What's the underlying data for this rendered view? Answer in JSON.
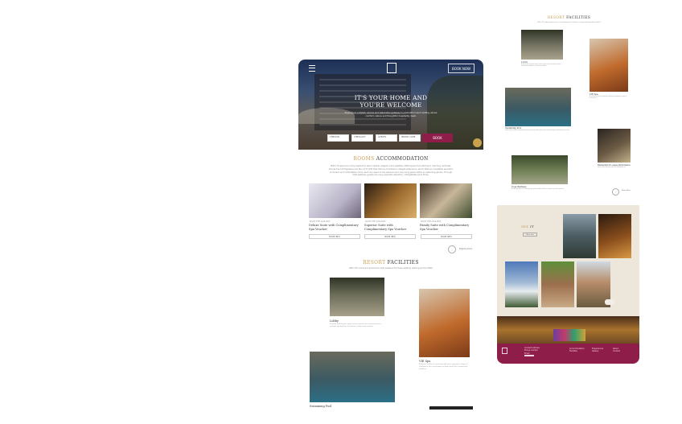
{
  "hero": {
    "book_now": "BOOK NOW",
    "title_line1": "IT'S YOUR HOME AND",
    "title_line2": "YOU'RE WELCOME",
    "subtitle": "Experience a stylish, serene and restorative getaway in a beautiful resort setting, where comfort, nature and thoughtful hospitality meet.",
    "fields": [
      "CHECK-IN",
      "CHECK-OUT",
      "GUESTS",
      "PROMO CODE"
    ],
    "book_label": "BOOK"
  },
  "rooms": {
    "title_gold": "ROOMS",
    "title_dark": "ACCOMMODATION",
    "description": "With 175 spacious rooms inspired by warm neutral, elegant colour palettes, 2000 square foot starting to charming rainforest. Choose the 120 Signature and the 1,277 with their balcony furnished in elegant extensions, which offers an irresistible sensation of modern and comfortable rooms, each one opens to the spacious and cozy living space within an extending garden. Through total wellness, guests can enjoy peaceful relaxation, unforgettable good times.",
    "items": [
      {
        "label": "ROOM TYPE AVAILABLE",
        "title": "Deluxe Suite with Complimentary Spa Voucher",
        "more": "MORE INFO"
      },
      {
        "label": "ROOM TYPE AVAILABLE",
        "title": "Superior Suite with Complimentary Spa Voucher",
        "more": "MORE INFO"
      },
      {
        "label": "ROOM TYPE AVAILABLE",
        "title": "Family Suite with Complimentary Spa Voucher",
        "more": "MORE INFO"
      }
    ],
    "explore": "Explore more"
  },
  "facilities": {
    "title_gold": "RESORT",
    "title_dark": "FACILITIES",
    "description": "With 175 rooms and services to sixty pleasure for those seeking relaxing and fun-filled",
    "items": [
      {
        "name": "Lobby",
        "desc": "A grand and elegant space where guests are welcomed into a tranquil atmosphere of timeless charm and comfort."
      },
      {
        "name": "VIE Spa",
        "desc": "A holistic wellness sanctuary offering a signature range of treatments for rejuvenation of body and spirit, inspired by tradition."
      },
      {
        "name": "Swimming Pool",
        "desc": ""
      }
    ]
  },
  "right_facilities": {
    "title_gold": "RESORT",
    "title_dark": "FACILITIES",
    "description": "With 175 rooms and services to sixty pleasure for those seeking relaxing and fun-filled",
    "items": [
      {
        "name": "Lobby",
        "desc": "A grand and elegant space where guests are welcomed into a tranquil atmosphere of timeless charm."
      },
      {
        "name": "VIE Spa",
        "desc": "A holistic wellness sanctuary offering a signature range of treatments."
      },
      {
        "name": "Swimming Pool",
        "desc": "Relax by the pool surrounded by lush greenery and resort views, with loungers and attentive service."
      },
      {
        "name": "Restaurant & Lounge Performance",
        "desc": "Savor refined dining with live performances."
      },
      {
        "name": "Yoga Wellness",
        "desc": "A calm pavilion for morning yoga and mindful wellness sessions amid the garden."
      }
    ],
    "explore": "Show More"
  },
  "see": {
    "title_gold": "SEE",
    "title_dark": "IT",
    "button": "More Info"
  },
  "footer": {
    "col1": [
      "Contact Address",
      "Phone number",
      "Email"
    ],
    "col2": [
      "Accommodation",
      "Facilities"
    ],
    "col3": [
      "Experiences",
      "Gallery"
    ],
    "col4": [
      "About",
      "Contact"
    ]
  }
}
